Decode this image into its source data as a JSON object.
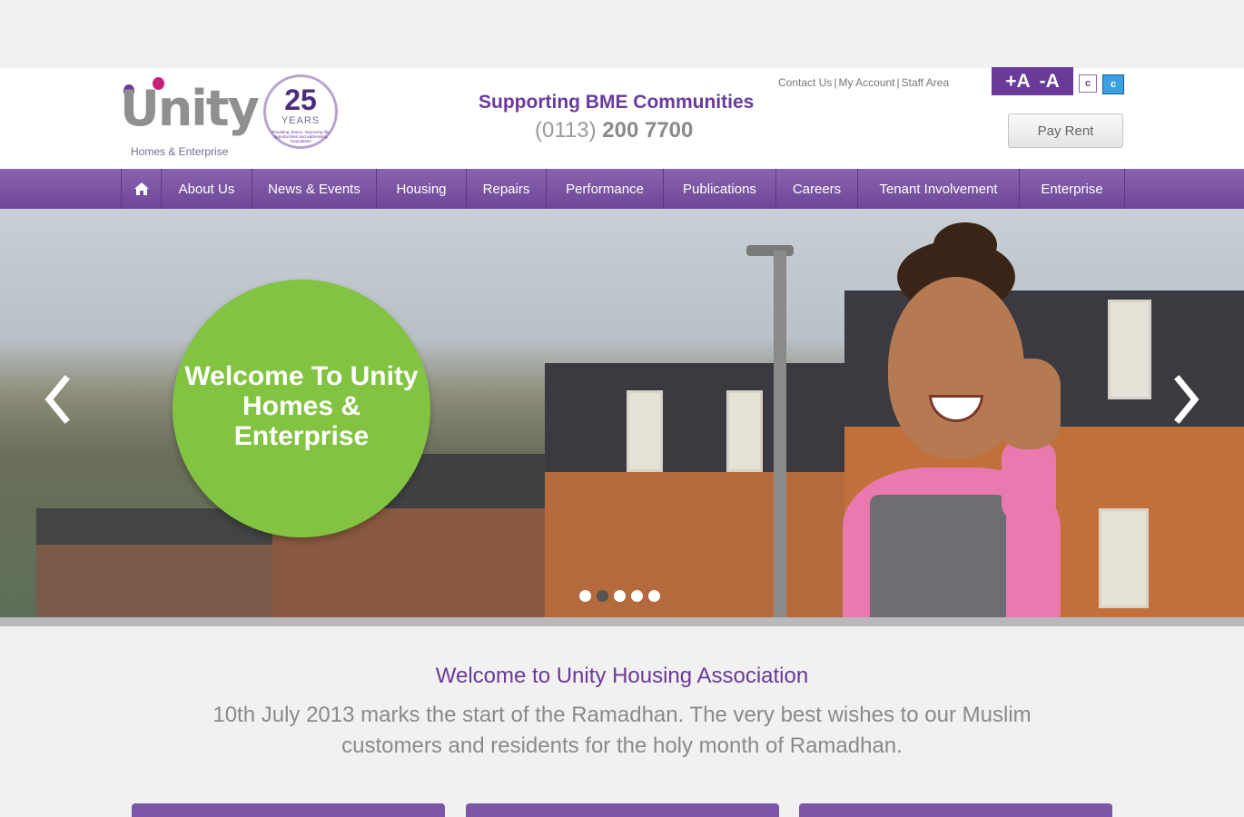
{
  "logo": {
    "wordmark": "Unity",
    "tagline": "Homes & Enterprise"
  },
  "anniversary": {
    "number": "25",
    "label": "YEARS",
    "tagline": "Providing choice, improving life opportunities and addressing inequalities"
  },
  "header": {
    "support_text": "Supporting BME Communities",
    "phone_prefix": "(0113)",
    "phone_number": "200 7700"
  },
  "top_links": [
    "Contact Us",
    "My Account",
    "Staff Area"
  ],
  "text_size": {
    "increase": "+A",
    "decrease": "-A"
  },
  "contrast": [
    "c",
    "c"
  ],
  "pay_rent": "Pay Rent",
  "nav": {
    "home_icon": "home-icon",
    "items": [
      "About Us",
      "News & Events",
      "Housing",
      "Repairs",
      "Performance",
      "Publications",
      "Careers",
      "Tenant Involvement",
      "Enterprise"
    ]
  },
  "hero": {
    "welcome_text": "Welcome To Unity Homes & Enterprise",
    "prev_icon": "chevron-left-icon",
    "next_icon": "chevron-right-icon",
    "slide_count": 5,
    "active_slide": 2
  },
  "main": {
    "title": "Welcome to Unity Housing Association",
    "body": "10th July 2013 marks the start of the Ramadhan. The very best wishes to our Muslim customers and residents for the holy month of Ramadhan."
  },
  "colors": {
    "brand_purple": "#6a3a98",
    "nav_purple": "#7d56a6",
    "welcome_green": "#82c341",
    "contrast_blue": "#3aa0e0"
  }
}
